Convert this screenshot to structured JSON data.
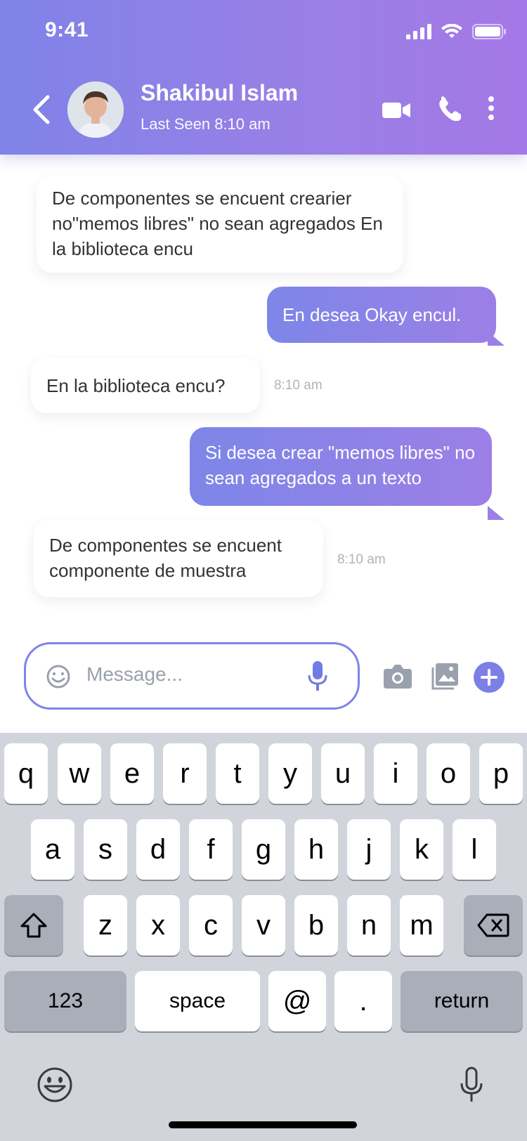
{
  "status_bar": {
    "time": "9:41"
  },
  "header": {
    "name": "Shakibul Islam",
    "last_seen": "Last Seen 8:10 am"
  },
  "messages": [
    {
      "side": "in",
      "text": "De componentes se encuent crearier no\"memos libres\" no sean agregados En la biblioteca encu"
    },
    {
      "side": "out",
      "text": "En desea Okay encul."
    },
    {
      "side": "in",
      "text": "En la biblioteca encu?",
      "time": "8:10 am"
    },
    {
      "side": "out",
      "text": "Si desea crear \"memos libres\" no sean agregados a un texto"
    },
    {
      "side": "in",
      "text": "De componentes se encuent componente de muestra",
      "time": "8:10 am"
    }
  ],
  "composer": {
    "placeholder": "Message..."
  },
  "keyboard": {
    "row1": [
      "q",
      "w",
      "e",
      "r",
      "t",
      "y",
      "u",
      "i",
      "o",
      "p"
    ],
    "row2": [
      "a",
      "s",
      "d",
      "f",
      "g",
      "h",
      "j",
      "k",
      "l"
    ],
    "row3": [
      "z",
      "x",
      "c",
      "v",
      "b",
      "n",
      "m"
    ],
    "numbers": "123",
    "space": "space",
    "at": "@",
    "dot": ".",
    "return": "return"
  },
  "colors": {
    "accent": "#7c85e6",
    "header_start": "#7f83e8",
    "header_end": "#a478e6"
  }
}
